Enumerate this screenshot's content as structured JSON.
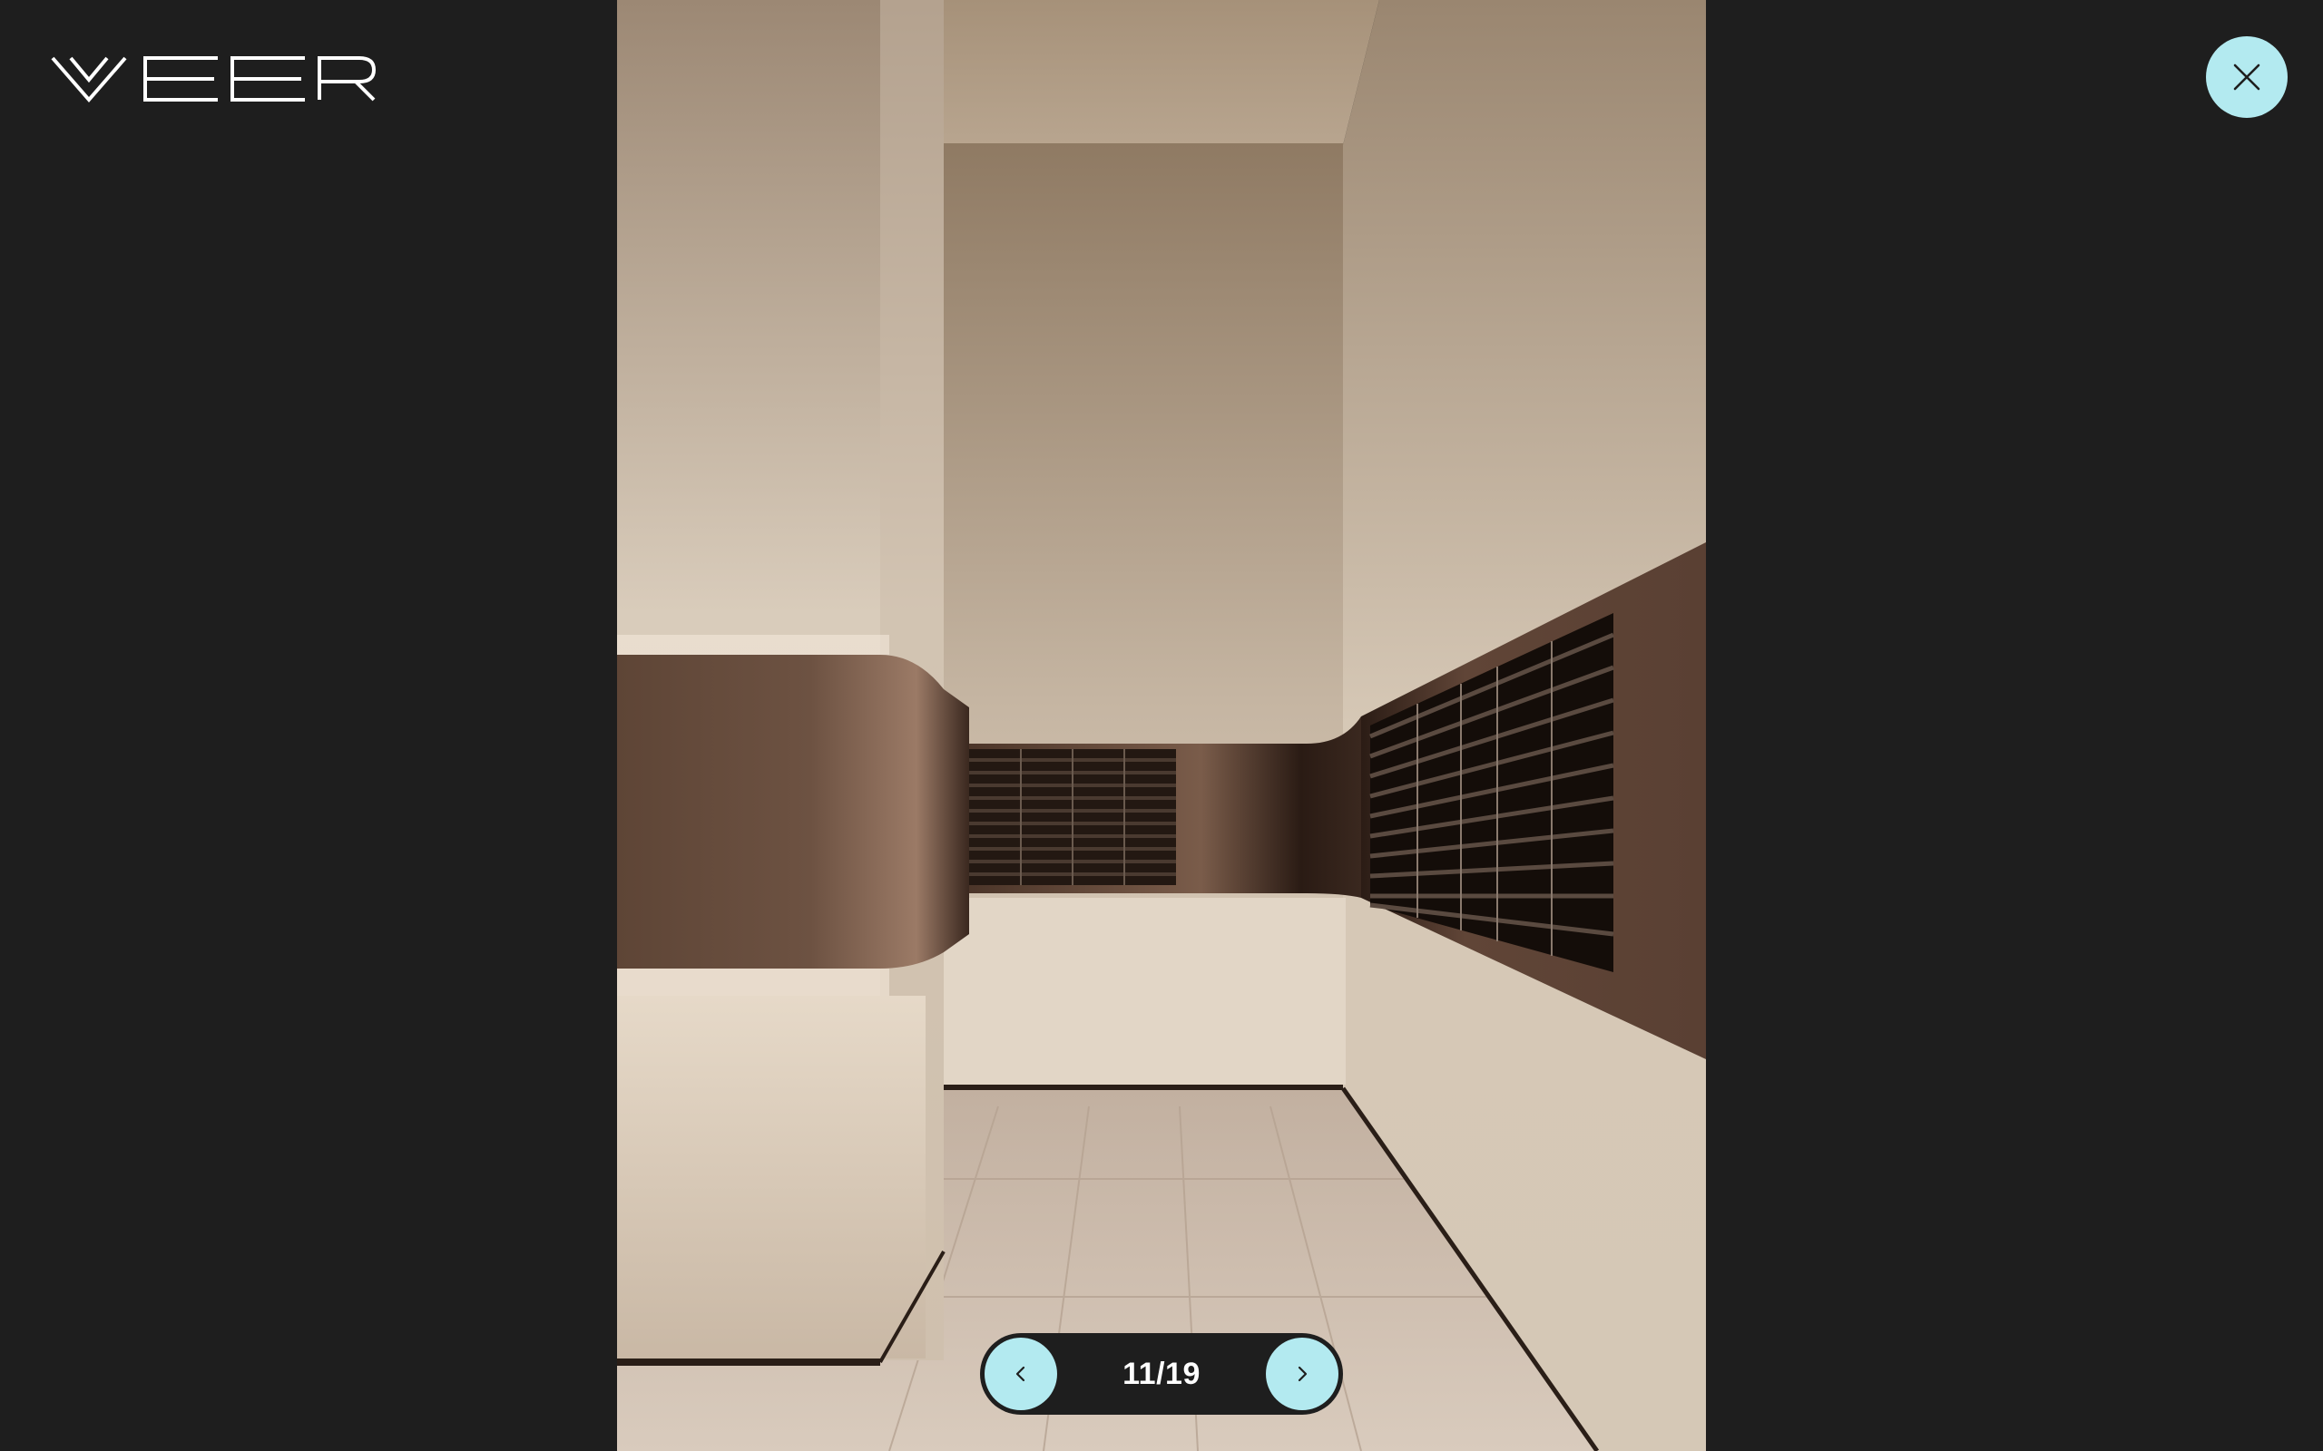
{
  "brand": {
    "logo_text": "VEER",
    "logo_icon": "veer-wordmark"
  },
  "close": {
    "icon": "close-icon",
    "accent": "#b3eaf0"
  },
  "gallery": {
    "image_icon": "lobby-mailroom-render",
    "pager": {
      "counter": "11/19",
      "prev_icon": "chevron-left-icon",
      "next_icon": "chevron-right-icon"
    }
  },
  "colors": {
    "background": "#1e1e1e",
    "accent": "#b3eaf0",
    "text": "#ffffff"
  }
}
